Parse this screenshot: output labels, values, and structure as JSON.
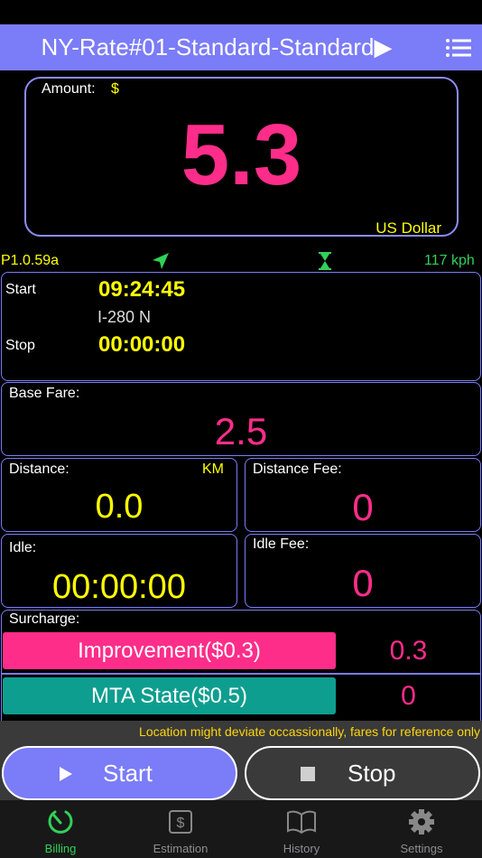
{
  "header": {
    "title": "NY-Rate#01-Standard-Standard▶",
    "menu_icon": "list-icon"
  },
  "amount": {
    "label": "Amount:",
    "currency_symbol": "$",
    "value": "5.3",
    "currency_name": "US Dollar"
  },
  "status": {
    "version": "P1.0.59a",
    "gps_icon": "location-arrow-icon",
    "timer_icon": "hourglass-icon",
    "speed": "117",
    "speed_unit": "kph"
  },
  "trip": {
    "start_label": "Start",
    "start_time": "09:24:45",
    "location": "I-280 N",
    "stop_label": "Stop",
    "stop_time": "00:00:00"
  },
  "base_fare": {
    "label": "Base Fare:",
    "value": "2.5"
  },
  "distance": {
    "label": "Distance:",
    "unit": "KM",
    "value": "0.0"
  },
  "distance_fee": {
    "label": "Distance Fee:",
    "value": "0"
  },
  "idle": {
    "label": "Idle:",
    "value": "00:00:00"
  },
  "idle_fee": {
    "label": "Idle Fee:",
    "value": "0"
  },
  "surcharge": {
    "label": "Surcharge:",
    "items": [
      {
        "label": "Improvement($0.3)",
        "value": "0.3",
        "color": "#ff2d8a"
      },
      {
        "label": "MTA State($0.5)",
        "value": "0",
        "color": "#0e9e8f"
      }
    ]
  },
  "notice": "Location might deviate occassionally, fares for reference only",
  "controls": {
    "start_label": "Start",
    "stop_label": "Stop"
  },
  "tabs": [
    {
      "label": "Billing",
      "icon": "gauge-icon",
      "active": true
    },
    {
      "label": "Estimation",
      "icon": "dollar-sign-icon",
      "active": false
    },
    {
      "label": "History",
      "icon": "book-icon",
      "active": false
    },
    {
      "label": "Settings",
      "icon": "gear-icon",
      "active": false
    }
  ],
  "colors": {
    "accent": "#7b7cf7",
    "pink": "#ff2d8a",
    "yellow": "#ffff00",
    "green": "#30d158",
    "teal": "#0e9e8f"
  }
}
